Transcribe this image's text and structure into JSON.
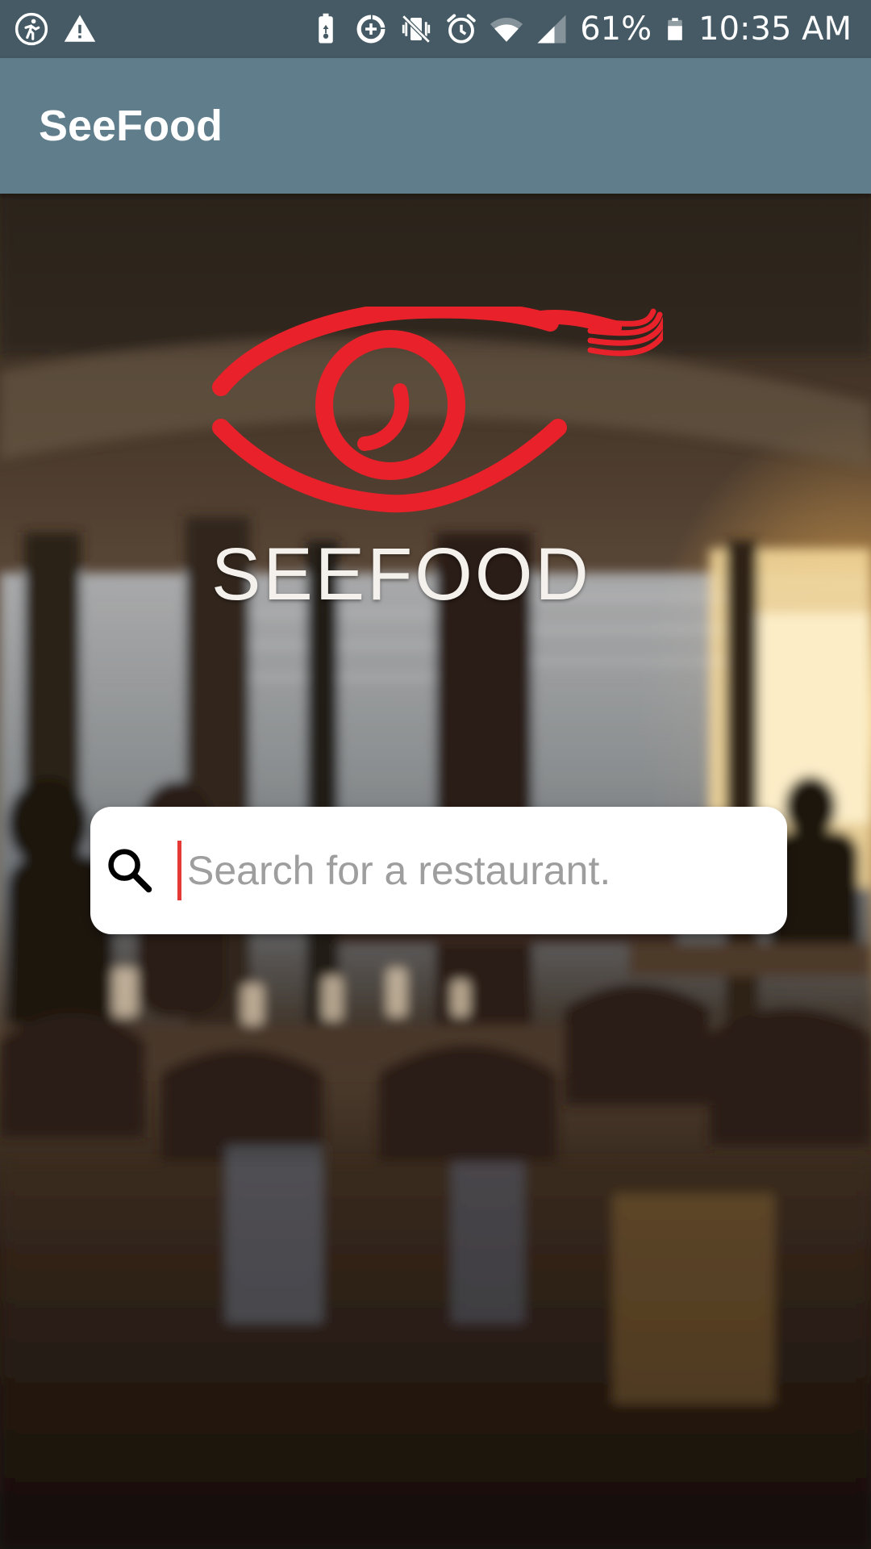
{
  "status_bar": {
    "left_icons": [
      "running-icon",
      "warning-icon"
    ],
    "right_icons": [
      "battery-saver-icon",
      "data-saver-icon",
      "vibrate-icon",
      "alarm-icon",
      "wifi-icon",
      "signal-icon",
      "battery-icon"
    ],
    "battery_percent": "61%",
    "time": "10:35 AM"
  },
  "app_bar": {
    "title": "SeeFood"
  },
  "logo": {
    "wordmark": "SEEFOOD",
    "color": "#e8212a"
  },
  "search": {
    "placeholder": "Search for a restaurant.",
    "value": ""
  },
  "colors": {
    "status_bar": "#455a64",
    "app_bar": "#607d8b",
    "accent": "#e53935"
  }
}
